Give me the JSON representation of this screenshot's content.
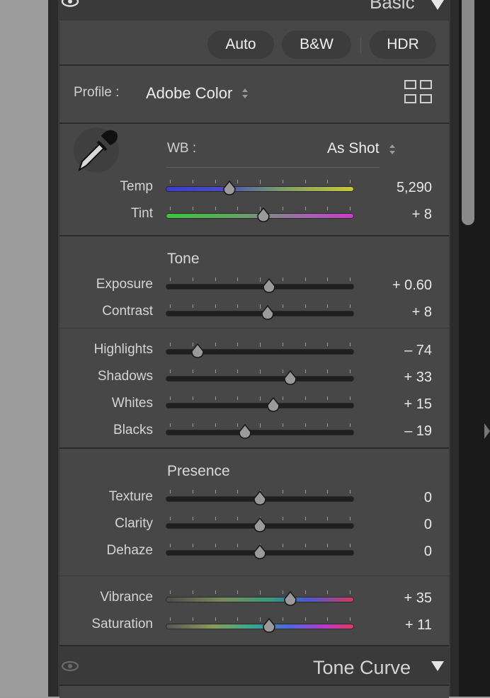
{
  "basic_panel": {
    "title": "Basic",
    "buttons": {
      "auto": "Auto",
      "bw": "B&W",
      "hdr": "HDR"
    },
    "profile_label": "Profile :",
    "profile_value": "Adobe Color",
    "wb_label": "WB :",
    "wb_value": "As Shot",
    "tone_title": "Tone",
    "presence_title": "Presence",
    "sliders": {
      "temp": {
        "label": "Temp",
        "value": "5,290",
        "position": 0.34
      },
      "tint": {
        "label": "Tint",
        "value": "+ 8",
        "position": 0.52
      },
      "exposure": {
        "label": "Exposure",
        "value": "+ 0.60",
        "position": 0.55
      },
      "contrast": {
        "label": "Contrast",
        "value": "+ 8",
        "position": 0.54
      },
      "highlights": {
        "label": "Highlights",
        "value": "– 74",
        "position": 0.17
      },
      "shadows": {
        "label": "Shadows",
        "value": "+ 33",
        "position": 0.66
      },
      "whites": {
        "label": "Whites",
        "value": "+ 15",
        "position": 0.57
      },
      "blacks": {
        "label": "Blacks",
        "value": "– 19",
        "position": 0.42
      },
      "texture": {
        "label": "Texture",
        "value": "0",
        "position": 0.5
      },
      "clarity": {
        "label": "Clarity",
        "value": "0",
        "position": 0.5
      },
      "dehaze": {
        "label": "Dehaze",
        "value": "0",
        "position": 0.5
      },
      "vibrance": {
        "label": "Vibrance",
        "value": "+ 35",
        "position": 0.66
      },
      "saturation": {
        "label": "Saturation",
        "value": "+ 11",
        "position": 0.55
      }
    }
  },
  "tone_curve_panel": {
    "title": "Tone Curve"
  },
  "colors": {
    "panel_bg": "#474747",
    "panel_dark": "#3a3a3a",
    "text": "#d6d6d6",
    "value_text": "#e8e8e8"
  },
  "icons": {
    "eye": "eye-icon",
    "dropper": "eyedropper-icon",
    "grid": "profile-grid-icon",
    "collapse": "triangle-down-icon"
  }
}
